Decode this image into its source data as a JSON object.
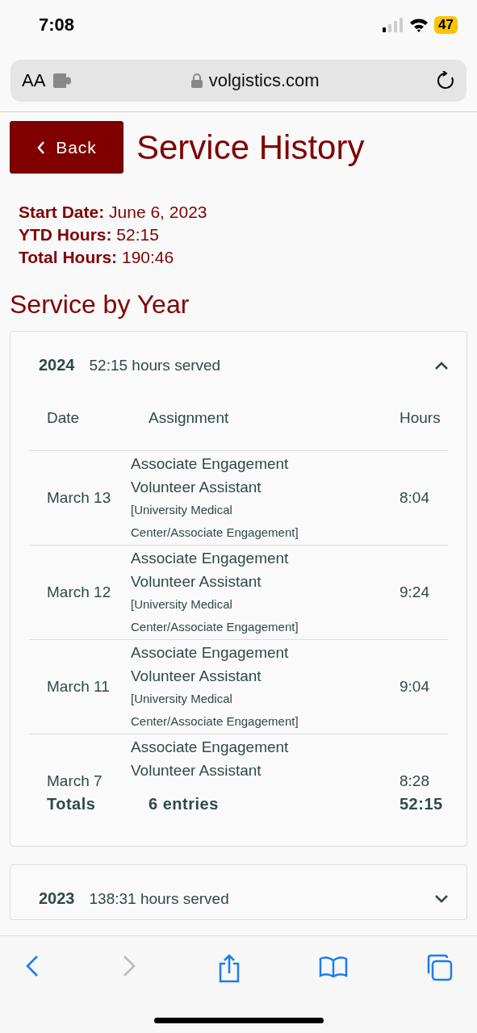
{
  "status_bar": {
    "time": "7:08",
    "battery": "47"
  },
  "address_bar": {
    "text_size": "AA",
    "url": "volgistics.com"
  },
  "back_button": {
    "label": "Back"
  },
  "title": "Service History",
  "summary": [
    {
      "label": "Start Date:",
      "value": "June 6, 2023"
    },
    {
      "label": "YTD Hours:",
      "value": "52:15"
    },
    {
      "label": "Total Hours:",
      "value": "190:46"
    }
  ],
  "section_title": "Service by Year",
  "years": [
    {
      "year": "2024",
      "hours": "52:15 hours served",
      "expanded": true,
      "table": {
        "columns": [
          "Date",
          "Assignment",
          "Hours"
        ],
        "rows": [
          {
            "date": "March 13",
            "assignment": "Associate Engagement Volunteer Assistant",
            "location": "[University Medical Center/Associate Engagement]",
            "hours": "8:04"
          },
          {
            "date": "March 12",
            "assignment": "Associate Engagement Volunteer Assistant",
            "location": "[University Medical Center/Associate Engagement]",
            "hours": "9:24"
          },
          {
            "date": "March 11",
            "assignment": "Associate Engagement Volunteer Assistant",
            "location": "[University Medical Center/Associate Engagement]",
            "hours": "9:04"
          },
          {
            "date": "March 7",
            "assignment": "Associate Engagement Volunteer Assistant",
            "hours": "8:28"
          }
        ],
        "totals": {
          "label": "Totals",
          "entries": "6 entries",
          "hours": "52:15"
        }
      }
    },
    {
      "year": "2023",
      "hours": "138:31 hours served",
      "expanded": false
    }
  ]
}
